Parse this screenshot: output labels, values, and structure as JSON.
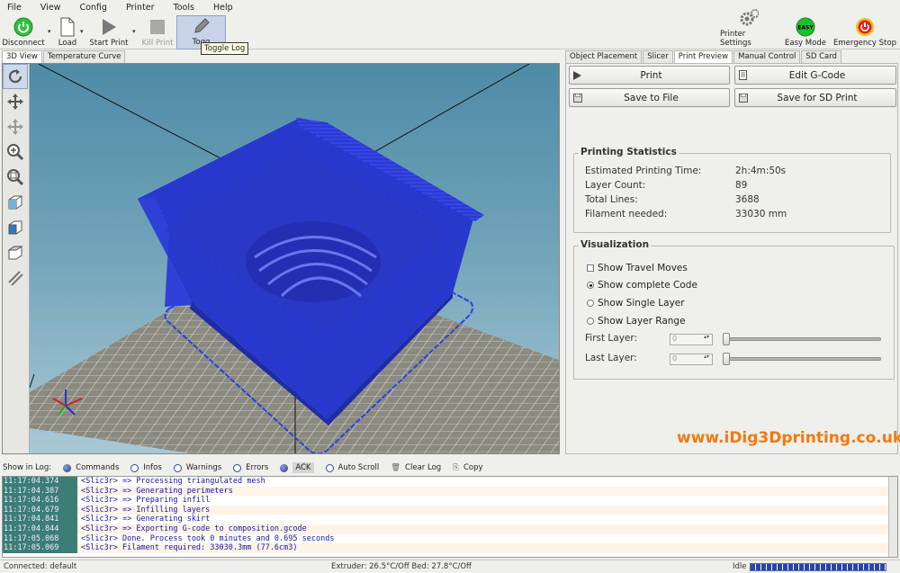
{
  "menu": [
    "File",
    "View",
    "Config",
    "Printer",
    "Tools",
    "Help"
  ],
  "toolbar": {
    "disconnect": "Disconnect",
    "load": "Load",
    "start_print": "Start Print",
    "kill_print": "Kill Print",
    "toggle": "Togg",
    "printer_settings": "Printer Settings",
    "easy_mode": "Easy Mode",
    "easy_badge": "EASY",
    "emergency_stop": "Emergency Stop"
  },
  "tooltip": "Toggle Log",
  "left_tabs": [
    "3D View",
    "Temperature Curve"
  ],
  "right_tabs": [
    "Object Placement",
    "Slicer",
    "Print Preview",
    "Manual Control",
    "SD Card"
  ],
  "buttons": {
    "print": "Print",
    "edit_gcode": "Edit G-Code",
    "save_to_file": "Save to File",
    "save_sd": "Save for SD Print"
  },
  "stats": {
    "title": "Printing Statistics",
    "rows": [
      {
        "label": "Estimated Printing Time:",
        "value": "2h:4m:50s"
      },
      {
        "label": "Layer Count:",
        "value": "89"
      },
      {
        "label": "Total Lines:",
        "value": "3688"
      },
      {
        "label": "Filament needed:",
        "value": "33030 mm"
      }
    ]
  },
  "viz": {
    "title": "Visualization",
    "travel": "Show Travel Moves",
    "complete": "Show complete Code",
    "single": "Show Single Layer",
    "range": "Show Layer Range",
    "first_layer": "First Layer:",
    "last_layer": "Last Layer:",
    "first_value": "0",
    "last_value": "0"
  },
  "watermark": "www.iDig3Dprinting.co.uk",
  "logbar": {
    "show_in_log": "Show in Log:",
    "commands": "Commands",
    "infos": "Infos",
    "warnings": "Warnings",
    "errors": "Errors",
    "ack": "ACK",
    "autoscroll": "Auto Scroll",
    "clear": "Clear Log",
    "copy": "Copy"
  },
  "log": [
    {
      "time": "11:17:04.374",
      "msg": "<Slic3r> => Processing triangulated mesh"
    },
    {
      "time": "11:17:04.387",
      "msg": "<Slic3r> => Generating perimeters"
    },
    {
      "time": "11:17:04.616",
      "msg": "<Slic3r> => Preparing infill"
    },
    {
      "time": "11:17:04.679",
      "msg": "<Slic3r> => Infilling layers"
    },
    {
      "time": "11:17:04.841",
      "msg": "<Slic3r> => Generating skirt"
    },
    {
      "time": "11:17:04.844",
      "msg": "<Slic3r> => Exporting G-code to composition.gcode"
    },
    {
      "time": "11:17:05.068",
      "msg": "<Slic3r> Done. Process took 0 minutes and 0.695 seconds"
    },
    {
      "time": "11:17:05.069",
      "msg": "<Slic3r> Filament required: 33030.3mm (77.6cm3)"
    }
  ],
  "status": {
    "connected": "Connected: default",
    "temps": "Extruder: 26.5°C/Off Bed: 27.8°C/Off",
    "idle": "Idle",
    "progress": 1.0
  },
  "colors": {
    "model": "#2f3fe0",
    "bed": "#8a8a80",
    "accent": "#f07a10"
  }
}
